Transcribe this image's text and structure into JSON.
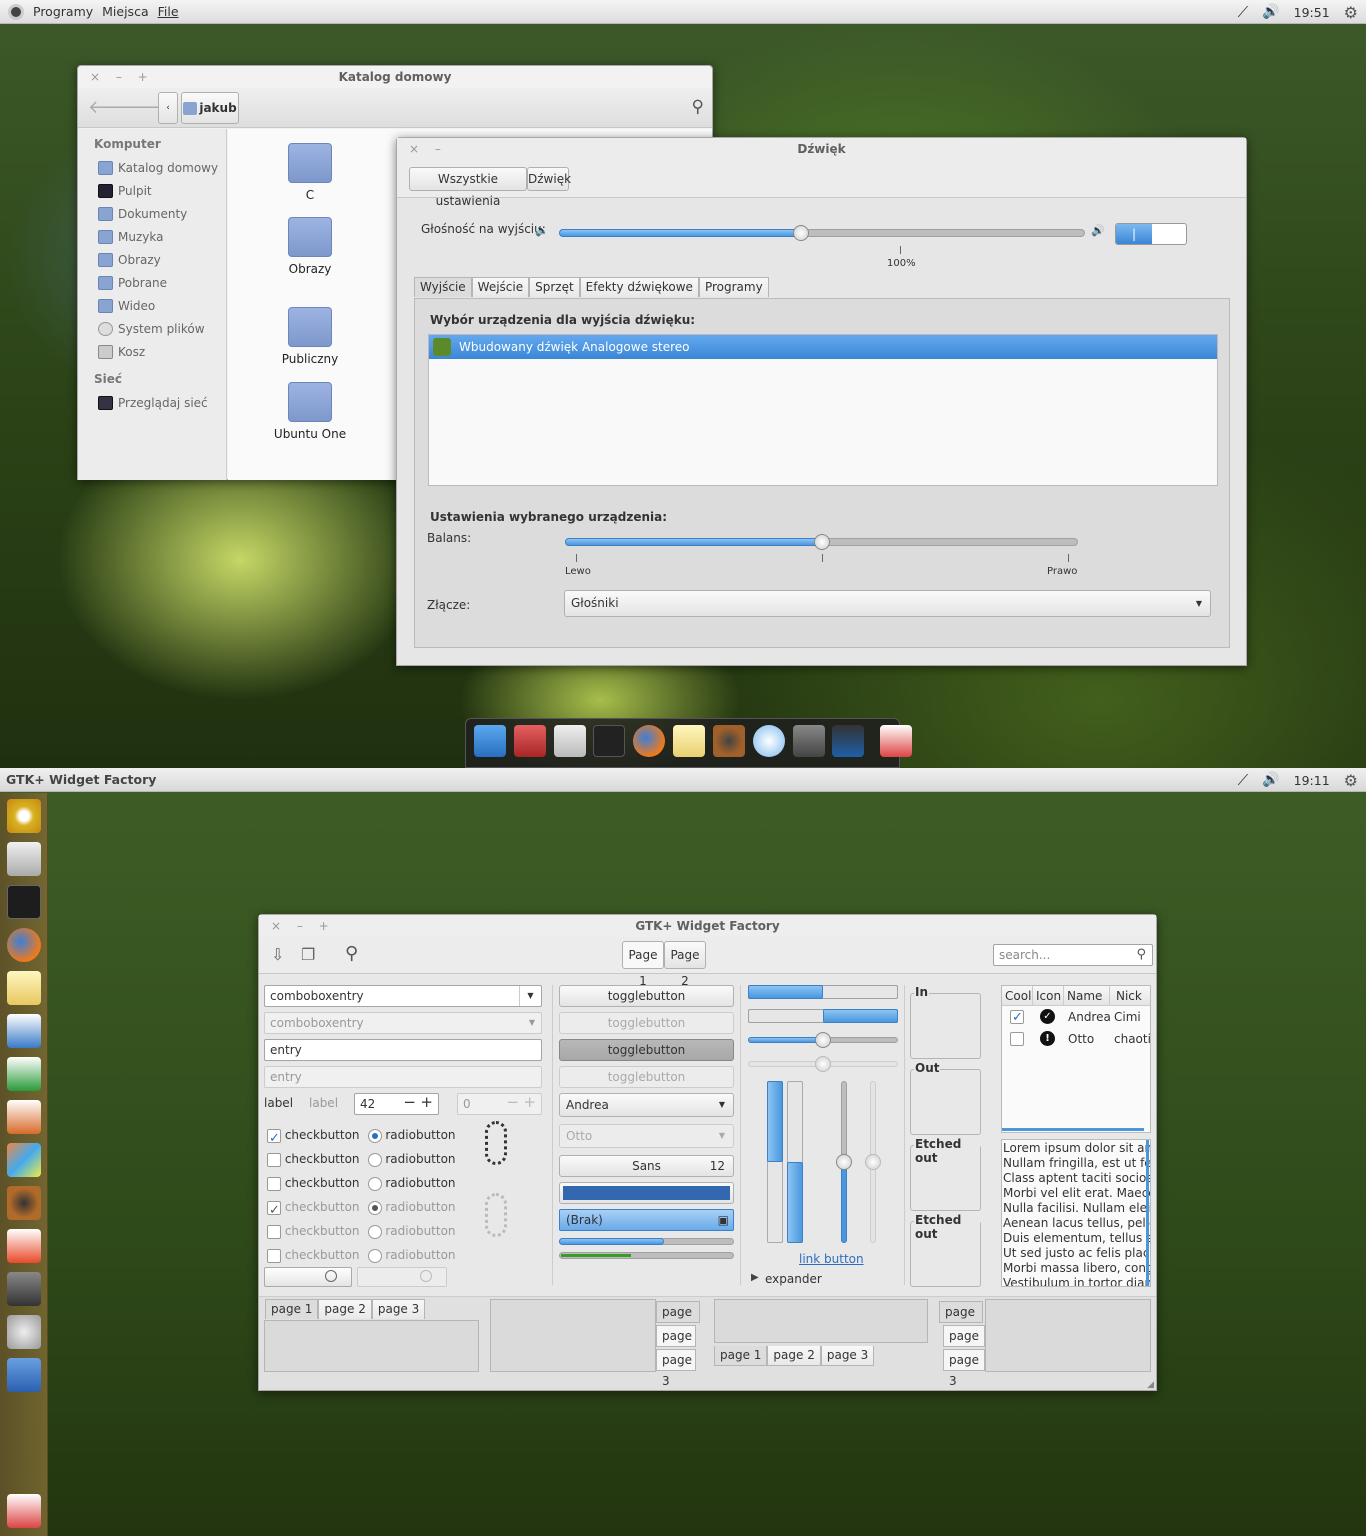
{
  "shot1": {
    "panel": {
      "menu": [
        "Programy",
        "Miejsca",
        "File"
      ],
      "clock": "19:51"
    },
    "files": {
      "title": "Katalog domowy",
      "location": "jakub",
      "sidebar": {
        "head1": "Komputer",
        "items": [
          "Katalog domowy",
          "Pulpit",
          "Dokumenty",
          "Muzyka",
          "Obrazy",
          "Pobrane",
          "Wideo",
          "System plików",
          "Kosz"
        ],
        "head2": "Sieć",
        "net": "Przeglądaj sieć"
      },
      "folders": [
        "C",
        "Obrazy",
        "Publiczny",
        "Ubuntu One"
      ]
    },
    "sound": {
      "title": "Dźwięk",
      "breadcrumb": [
        "Wszystkie ustawienia",
        "Dźwięk"
      ],
      "volume_label": "Głośność na wyjściu:",
      "volume_value": "100%",
      "volume_fraction": 0.46,
      "tabs": [
        "Wyjście",
        "Wejście",
        "Sprzęt",
        "Efekty dźwiękowe",
        "Programy"
      ],
      "device_heading": "Wybór urządzenia dla wyjścia dźwięku:",
      "device": "Wbudowany dźwięk Analogowe stereo",
      "settings_heading": "Ustawienia wybranego urządzenia:",
      "balance_label": "Balans:",
      "balance_left": "Lewo",
      "balance_right": "Prawo",
      "balance_fraction": 0.5,
      "connector_label": "Złącze:",
      "connector_value": "Głośniki"
    }
  },
  "shot2": {
    "panel": {
      "title": "GTK+ Widget Factory",
      "clock": "19:11"
    },
    "win": {
      "title": "GTK+ Widget Factory",
      "pages": [
        "Page 1",
        "Page 2"
      ],
      "search_placeholder": "search...",
      "combo1": "comboboxentry",
      "combo2": "comboboxentry",
      "entry1": "entry",
      "entry2": "entry",
      "label1": "label",
      "label2": "label",
      "spin1": "42",
      "spin2": "0",
      "check": "checkbutton",
      "radio": "radiobutton",
      "toggle": "togglebutton",
      "combo_andrea": "Andrea",
      "combo_otto": "Otto",
      "font_name": "Sans",
      "font_size": "12",
      "file_none": "(Brak)",
      "link": "link button",
      "expander": "expander",
      "frames": [
        "In",
        "Out",
        "Etched out",
        "Etched out"
      ],
      "tree_headers": [
        "Cool",
        "Icon",
        "Name",
        "Nick"
      ],
      "tree_rows": [
        {
          "name": "Andrea",
          "nick": "Cimi"
        },
        {
          "name": "Otto",
          "nick": "chaotic"
        }
      ],
      "lorem": [
        "Lorem ipsum dolor sit amet",
        "Nullam fringilla, est ut feugiat",
        "Class aptent taciti sociosqu",
        "Morbi vel elit erat. Maecenas",
        "Nulla facilisi. Nullam eleifend",
        "Aenean lacus tellus, pellentesque",
        "Duis elementum, tellus sed",
        "Ut sed justo ac felis placerat",
        "Morbi massa libero, congue",
        "Vestibulum in tortor diam, quis"
      ],
      "nb_tabs": [
        "page 1",
        "page 2",
        "page 3"
      ]
    }
  }
}
